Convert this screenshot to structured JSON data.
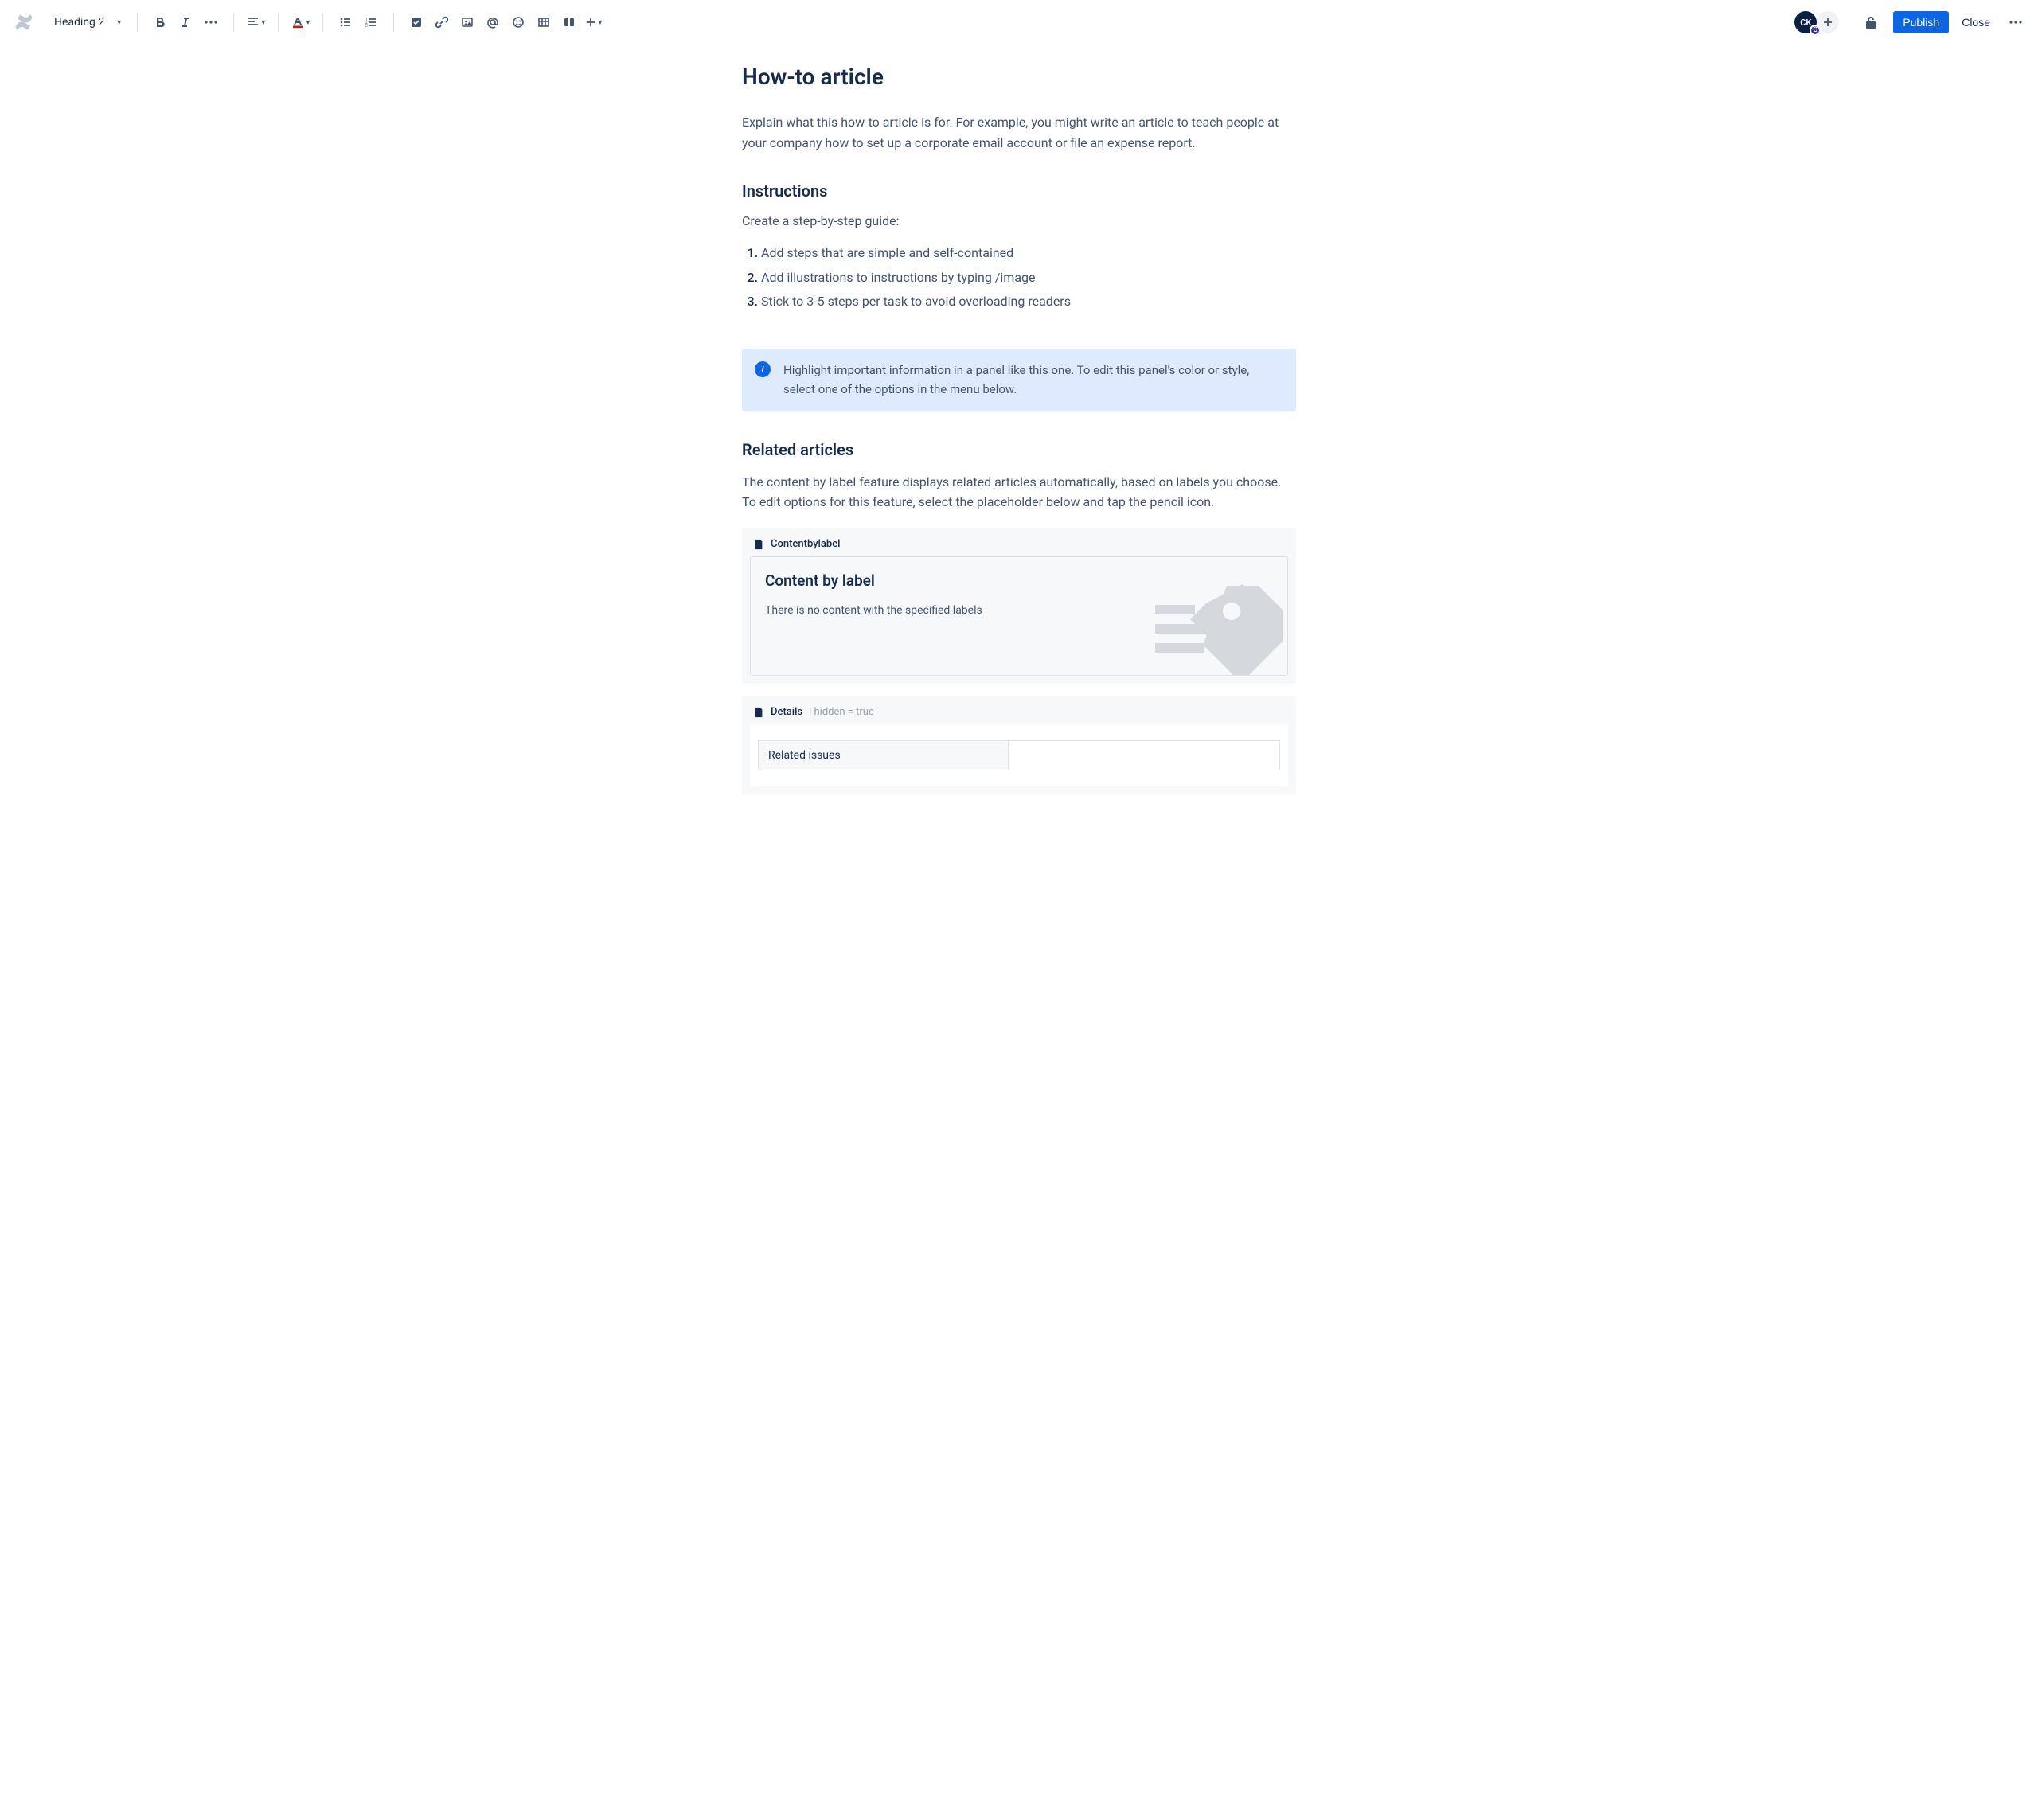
{
  "toolbar": {
    "textstyle": "Heading 2",
    "publish": "Publish",
    "close": "Close"
  },
  "avatar": {
    "initials": "CK",
    "badge": "C"
  },
  "page": {
    "title": "How-to article",
    "intro": "Explain what this how-to article is for. For example, you might write an article to teach people at your company how to set up a corporate email account or file an expense report.",
    "instructions_heading": "Instructions",
    "instructions_sub": "Create a step-by-step guide:",
    "steps": [
      "Add steps that are simple and self-contained",
      "Add illustrations to instructions by typing /image",
      "Stick to 3-5 steps per task to avoid overloading readers"
    ],
    "panel": "Highlight important information in a panel like this one. To edit this panel's color or style, select one of the options in the menu below.",
    "related_heading": "Related articles",
    "related_body": "The content by label feature displays related articles automatically, based on labels you choose. To edit options for this feature, select the placeholder below and tap the pencil icon.",
    "macro1": {
      "name": "Contentbylabel",
      "title": "Content by label",
      "empty": "There is no content with the specified labels"
    },
    "macro2": {
      "name": "Details",
      "meta": "| hidden = true",
      "row_label": "Related issues"
    }
  }
}
